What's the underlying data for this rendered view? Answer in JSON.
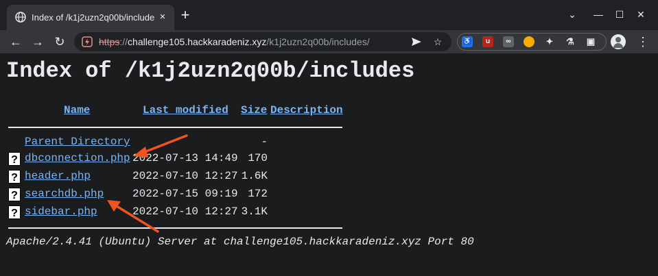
{
  "browser": {
    "tab": {
      "title": "Index of /k1j2uzn2q00b/includes",
      "close": "×"
    },
    "new_tab": "+",
    "window": {
      "chevron": "⌄",
      "minimize": "—",
      "maximize": "☐",
      "close": "✕"
    },
    "nav": {
      "back": "←",
      "forward": "→",
      "reload": "↻"
    },
    "url": {
      "scheme": "https",
      "separator": "://",
      "host": "challenge105.hackkaradeniz.xyz",
      "path": "/k1j2uzn2q00b/includes/"
    },
    "omnibox_icons": [
      "send-tab-icon",
      "bookmark-star-icon"
    ],
    "extensions": [
      {
        "name": "accessibility-extension-icon",
        "color": "#1a73e8",
        "glyph": "♿"
      },
      {
        "name": "ublock-icon",
        "color": "#b3261e",
        "glyph": "uO"
      },
      {
        "name": "spy-glasses-icon",
        "color": "#3c4043",
        "glyph": "👓"
      },
      {
        "name": "cookie-icon",
        "color": "#f9ab00",
        "glyph": "●"
      },
      {
        "name": "puzzle-extensions-icon",
        "color": "#35363a",
        "glyph": "✦"
      },
      {
        "name": "lab-flask-icon",
        "color": "#35363a",
        "glyph": "⚗"
      },
      {
        "name": "side-panel-icon",
        "color": "#35363a",
        "glyph": "▣"
      }
    ],
    "menu": "⋮"
  },
  "page": {
    "title": "Index of /k1j2uzn2q00b/includes",
    "headers": {
      "name": "Name",
      "last_modified": "Last modified",
      "size": "Size",
      "description": "Description"
    },
    "parent": {
      "name": "Parent Directory",
      "size": "-"
    },
    "files": [
      {
        "name": "dbconnection.php",
        "modified": "2022-07-13 14:49",
        "size": "170"
      },
      {
        "name": "header.php",
        "modified": "2022-07-10 12:27",
        "size": "1.6K"
      },
      {
        "name": "searchdb.php",
        "modified": "2022-07-15 09:19",
        "size": "172"
      },
      {
        "name": "sidebar.php",
        "modified": "2022-07-10 12:27",
        "size": "3.1K"
      }
    ],
    "address": "Apache/2.4.41 (Ubuntu) Server at challenge105.hackkaradeniz.xyz Port 80"
  },
  "colors": {
    "annotation_arrow": "#f0541e",
    "link": "#7ab4f5",
    "background": "#1b1c1e"
  }
}
